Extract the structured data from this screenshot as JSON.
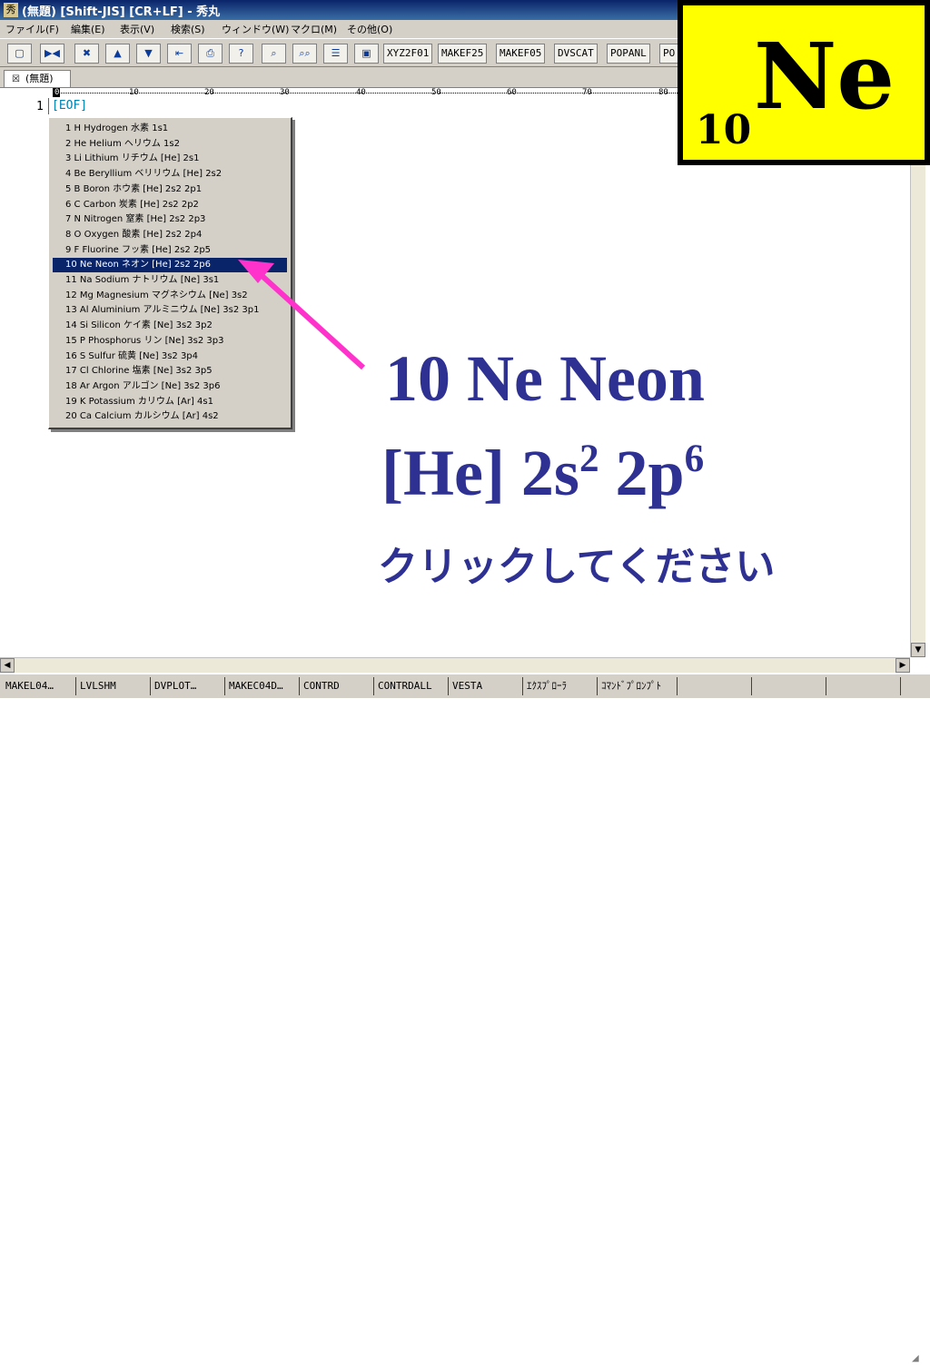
{
  "window": {
    "title": "(無題) [Shift-JIS] [CR+LF] - 秀丸",
    "app_icon": "hidemaru-icon"
  },
  "menu": [
    "ファイル(F)",
    "編集(E)",
    "表示(V)",
    "検索(S)",
    "ウィンドウ(W)",
    "マクロ(M)",
    "その他(O)"
  ],
  "toolbar": {
    "macro_buttons": [
      "XYZ2F01",
      "MAKEF25",
      "MAKEF05",
      "DVSCAT",
      "POPANL",
      "PO"
    ]
  },
  "tab": {
    "label": "(無題)",
    "close_icon": "close-icon"
  },
  "ruler": {
    "ticks": [
      "0",
      "10",
      "20",
      "30",
      "40",
      "50",
      "60",
      "70",
      "80"
    ]
  },
  "editor": {
    "line_number": "1",
    "eof": "[EOF]"
  },
  "popup": {
    "items": [
      "1 H Hydrogen 水素 1s1",
      "2 He Helium ヘリウム 1s2",
      "3 Li Lithium リチウム [He] 2s1",
      "4 Be Beryllium ベリリウム [He] 2s2",
      "5 B Boron ホウ素 [He] 2s2 2p1",
      "6 C Carbon 炭素 [He] 2s2 2p2",
      "7 N Nitrogen 窒素 [He] 2s2 2p3",
      "8 O Oxygen 酸素 [He] 2s2 2p4",
      "9 F Fluorine フッ素 [He] 2s2 2p5",
      "10 Ne Neon ネオン [He] 2s2 2p6",
      "11 Na Sodium ナトリウム [Ne] 3s1",
      "12 Mg Magnesium マグネシウム [Ne] 3s2",
      "13 Al Aluminium アルミニウム [Ne] 3s2 3p1",
      "14 Si Silicon ケイ素 [Ne] 3s2 3p2",
      "15 P Phosphorus リン [Ne] 3s2 3p3",
      "16 S Sulfur 硫黄 [Ne] 3s2 3p4",
      "17 Cl Chlorine 塩素 [Ne] 3s2 3p5",
      "18 Ar Argon アルゴン [Ne] 3s2 3p6",
      "19 K Potassium カリウム [Ar] 4s1",
      "20 Ca Calcium カルシウム [Ar] 4s2"
    ],
    "selected_index": 9
  },
  "element_badge": {
    "atomic_number": "10",
    "symbol": "Ne"
  },
  "annotation": {
    "heading": "10 Ne Neon",
    "config_core": "[He] 2s",
    "config_exp1": "2",
    "config_mid": " 2p",
    "config_exp2": "6",
    "prompt": "クリックしてください",
    "arrow_color": "#ff33cc",
    "text_color": "#2e3192"
  },
  "function_keys": [
    "MAKEL04…",
    "LVLSHM",
    "DVPLOT…",
    "MAKEC04D…",
    "CONTRD",
    "CONTRDALL",
    "VESTA",
    "ｴｸｽﾌﾟﾛｰﾗ",
    "ｺﾏﾝﾄﾞﾌﾟﾛﾝﾌﾟﾄ",
    "",
    "",
    ""
  ]
}
